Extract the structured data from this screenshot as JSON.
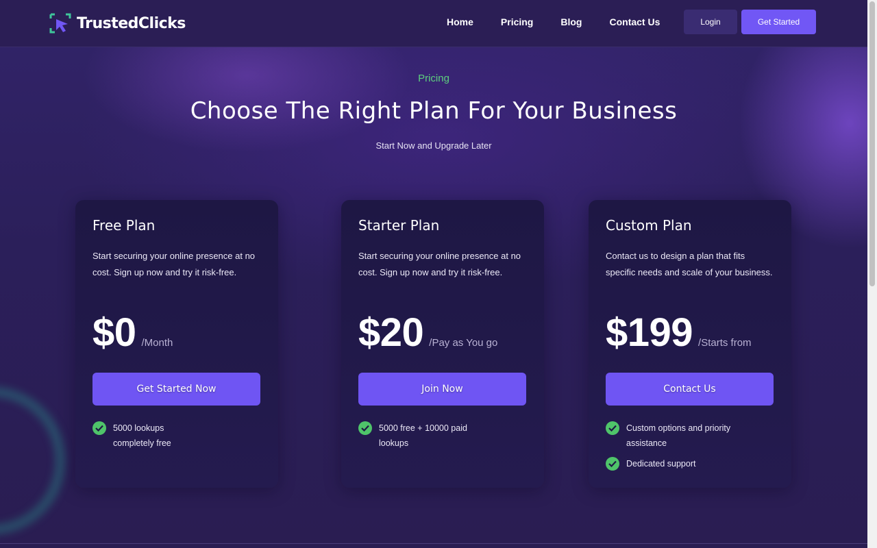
{
  "brand": {
    "name": "TrustedClicks",
    "accent": "#7157f5",
    "success": "#4fc46a"
  },
  "nav": {
    "items": [
      {
        "label": "Home"
      },
      {
        "label": "Pricing"
      },
      {
        "label": "Blog"
      },
      {
        "label": "Contact Us"
      }
    ],
    "login_label": "Login",
    "get_started_label": "Get Started"
  },
  "hero": {
    "eyebrow": "Pricing",
    "title": "Choose The Right Plan For Your Business",
    "subtitle": "Start Now and Upgrade Later"
  },
  "plans": [
    {
      "name": "Free Plan",
      "description": "Start securing your online presence at no cost. Sign up now and try it risk-free.",
      "price": "$0",
      "period": "/Month",
      "cta": "Get Started Now",
      "features": [
        "5000 lookups completely free"
      ]
    },
    {
      "name": "Starter Plan",
      "description": "Start securing your online presence at no cost. Sign up now and try it risk-free.",
      "price": "$20",
      "period": "/Pay as You go",
      "cta": "Join Now",
      "features": [
        "5000 free + 10000 paid lookups"
      ]
    },
    {
      "name": "Custom Plan",
      "description": "Contact us to design a plan that fits specific needs and scale of your business.",
      "price": "$199",
      "period": "/Starts from",
      "cta": "Contact Us",
      "features": [
        "Custom options and priority assistance",
        "Dedicated support"
      ]
    }
  ],
  "icons": {
    "check": "check-circle-icon",
    "logo": "cursor-click-icon"
  }
}
